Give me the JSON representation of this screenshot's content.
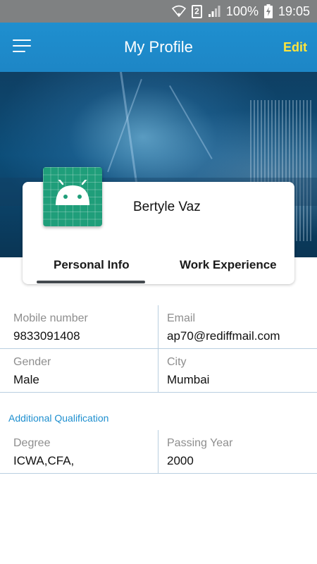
{
  "status_bar": {
    "sim_slot": "2",
    "battery": "100%",
    "time": "19:05"
  },
  "toolbar": {
    "title": "My Profile",
    "edit_label": "Edit"
  },
  "profile": {
    "name": "Bertyle Vaz"
  },
  "tabs": [
    {
      "label": "Personal Info",
      "selected": true
    },
    {
      "label": "Work Experience",
      "selected": false
    }
  ],
  "personal_info": {
    "mobile": {
      "label": "Mobile number",
      "value": "9833091408"
    },
    "email": {
      "label": "Email",
      "value": "ap70@rediffmail.com"
    },
    "gender": {
      "label": "Gender",
      "value": "Male"
    },
    "city": {
      "label": "City",
      "value": "Mumbai"
    }
  },
  "additional_qualification": {
    "title": "Additional Qualification",
    "degree": {
      "label": "Degree",
      "value": "ICWA,CFA,"
    },
    "passing_year": {
      "label": "Passing Year",
      "value": "2000"
    }
  },
  "colors": {
    "toolbar": "#1f8fcf",
    "edit_accent": "#ffe53b",
    "section_title": "#1e8fcf",
    "divider": "#b9cfe0"
  }
}
